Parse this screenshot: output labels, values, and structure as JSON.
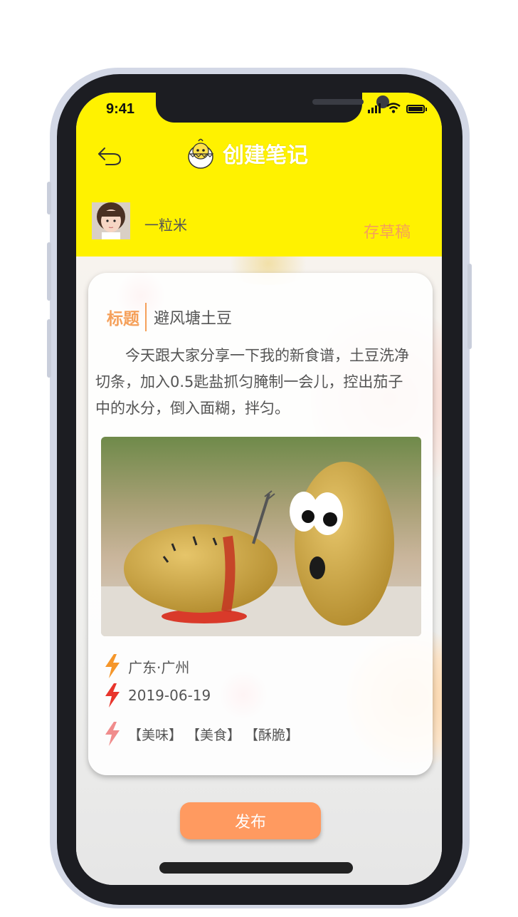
{
  "status_bar": {
    "time": "9:41"
  },
  "header": {
    "title": "创建笔记",
    "draft_label": "存草稿"
  },
  "user": {
    "name": "一粒米"
  },
  "note": {
    "title_label": "标题",
    "title_value": "避风塘土豆",
    "body": "今天跟大家分享一下我的新食谱，土豆洗净切条，加入0.5匙盐抓匀腌制一会儿，控出茄子中的水分，倒入面糊，拌匀。",
    "location": "广东·广州",
    "date": "2019-06-19",
    "tags": [
      "【美味】",
      "【美食】",
      "【酥脆】"
    ]
  },
  "actions": {
    "publish_label": "发布"
  },
  "colors": {
    "header_yellow": "#fff200",
    "accent_orange": "#f5a05a",
    "publish_button": "#ff9a60",
    "bolt_orange": "#f5962a",
    "bolt_red": "#e8352c",
    "bolt_pink": "#f08c8c"
  },
  "icons": [
    "back-arrow-icon",
    "chick-logo-icon",
    "location-bolt-icon",
    "date-bolt-icon",
    "tag-bolt-icon"
  ]
}
